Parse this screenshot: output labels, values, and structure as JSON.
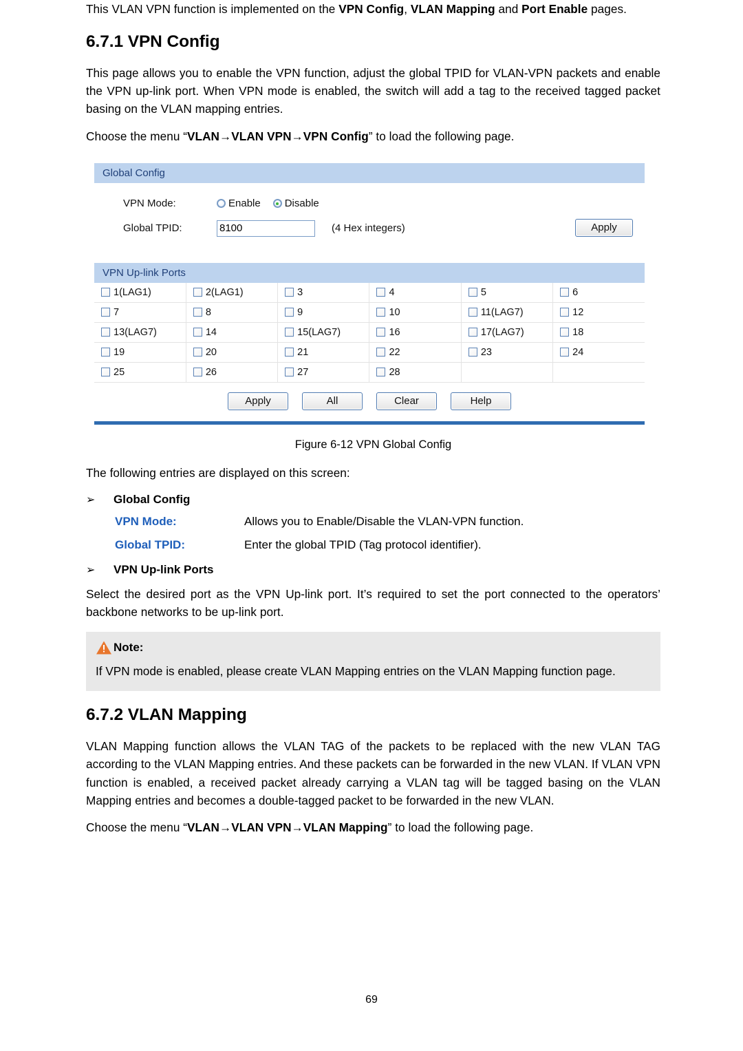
{
  "document": {
    "page_number": "69",
    "intro_paragraph": {
      "prefix": "This VLAN VPN function is implemented on the ",
      "term1": "VPN Config",
      "sep1": ", ",
      "term2": "VLAN Mapping",
      "sep2": " and ",
      "term3": "Port Enable",
      "suffix": " pages."
    },
    "section_671": {
      "heading": "6.7.1 VPN Config",
      "paragraph": "This page allows you to enable the VPN function, adjust the global TPID for VLAN-VPN packets and enable the VPN up-link port. When VPN mode is enabled, the switch will add a tag to the received tagged packet basing on the VLAN mapping entries.",
      "menu_prefix": "Choose the menu “",
      "menu_path": "VLAN→VLAN VPN→VPN Config",
      "menu_suffix": "” to load the following page."
    },
    "figure_caption": "Figure 6-12 VPN Global Config",
    "entries_lead": "The following entries are displayed on this screen:",
    "bullets": {
      "glyph": "➢",
      "global_config": "Global Config",
      "uplink_ports": "VPN Up-link Ports"
    },
    "definitions": [
      {
        "term": "VPN Mode:",
        "desc": "Allows you to Enable/Disable the VLAN-VPN function."
      },
      {
        "term": "Global TPID:",
        "desc": "Enter the global TPID (Tag protocol identifier)."
      }
    ],
    "uplink_paragraph": "Select the desired port as the VPN Up-link port. It’s required to set the port connected to the operators’ backbone networks to be up-link port.",
    "note": {
      "icon": "warning-triangle-icon",
      "title": "Note:",
      "text": "If VPN mode is enabled, please create VLAN Mapping entries on the VLAN Mapping function page."
    },
    "section_672": {
      "heading": "6.7.2 VLAN Mapping",
      "paragraph": "VLAN Mapping function allows the VLAN TAG of the packets to be replaced with the new VLAN TAG according to the VLAN Mapping entries. And these packets can be forwarded in the new VLAN. If VLAN VPN function is enabled, a received packet already carrying a VLAN tag will be tagged basing on the VLAN Mapping entries and becomes a double-tagged packet to be forwarded in the new VLAN.",
      "menu_prefix": "Choose the menu “",
      "menu_path": "VLAN→VLAN VPN→VLAN Mapping",
      "menu_suffix": "” to load the following page."
    }
  },
  "ui": {
    "global_config": {
      "header": "Global Config",
      "vpn_mode_label": "VPN Mode:",
      "radio_enable": "Enable",
      "radio_disable": "Disable",
      "selected_mode": "Disable",
      "global_tpid_label": "Global TPID:",
      "global_tpid_value": "8100",
      "global_tpid_hint": "(4 Hex integers)",
      "apply_label": "Apply"
    },
    "uplink_ports": {
      "header": "VPN Up-link Ports",
      "rows": [
        [
          "1(LAG1)",
          "2(LAG1)",
          "3",
          "4",
          "5",
          "6"
        ],
        [
          "7",
          "8",
          "9",
          "10",
          "11(LAG7)",
          "12"
        ],
        [
          "13(LAG7)",
          "14",
          "15(LAG7)",
          "16",
          "17(LAG7)",
          "18"
        ],
        [
          "19",
          "20",
          "21",
          "22",
          "23",
          "24"
        ],
        [
          "25",
          "26",
          "27",
          "28",
          "",
          ""
        ]
      ],
      "buttons": [
        "Apply",
        "All",
        "Clear",
        "Help"
      ]
    },
    "colors": {
      "panel_header_bg": "#bdd3ee",
      "panel_header_text": "#1f3f78",
      "panel_bottom_bar": "#2f6cb0",
      "radio_selected_dot": "#3cb63c",
      "term_blue": "#1f5fba",
      "note_bg": "#e8e8e8",
      "warning_orange": "#e8762c"
    }
  }
}
